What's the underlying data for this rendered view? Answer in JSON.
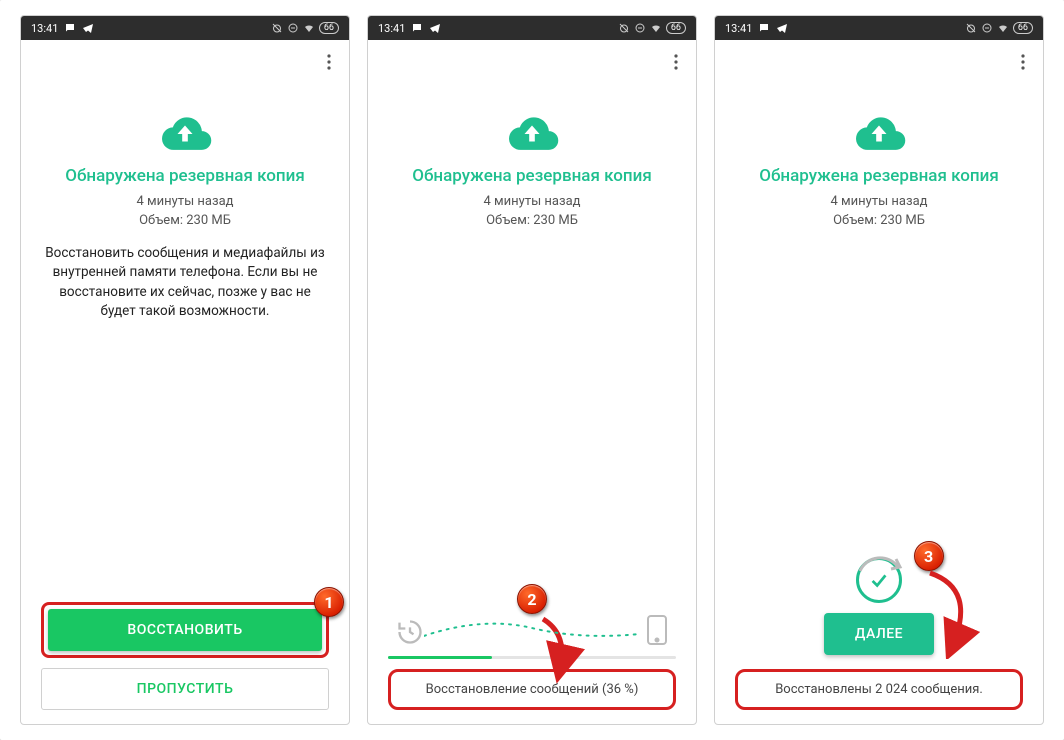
{
  "statusbar": {
    "time": "13:41",
    "battery": "66"
  },
  "common": {
    "title": "Обнаружена резервная копия",
    "time_ago": "4 минуты назад",
    "size": "Объем: 230 МБ"
  },
  "screens": [
    {
      "desc": "Восстановить сообщения и медиафайлы из внутренней памяти телефона. Если вы не восстановите их сейчас, позже у вас не будет такой возможности.",
      "primary": "ВОССТАНОВИТЬ",
      "secondary": "ПРОПУСТИТЬ",
      "callout": "1"
    },
    {
      "progress_pct": 36,
      "status": "Восстановление сообщений (36 %)",
      "callout": "2"
    },
    {
      "next": "ДАЛЕЕ",
      "status": "Восстановлены 2 024 сообщения.",
      "callout": "3"
    }
  ]
}
